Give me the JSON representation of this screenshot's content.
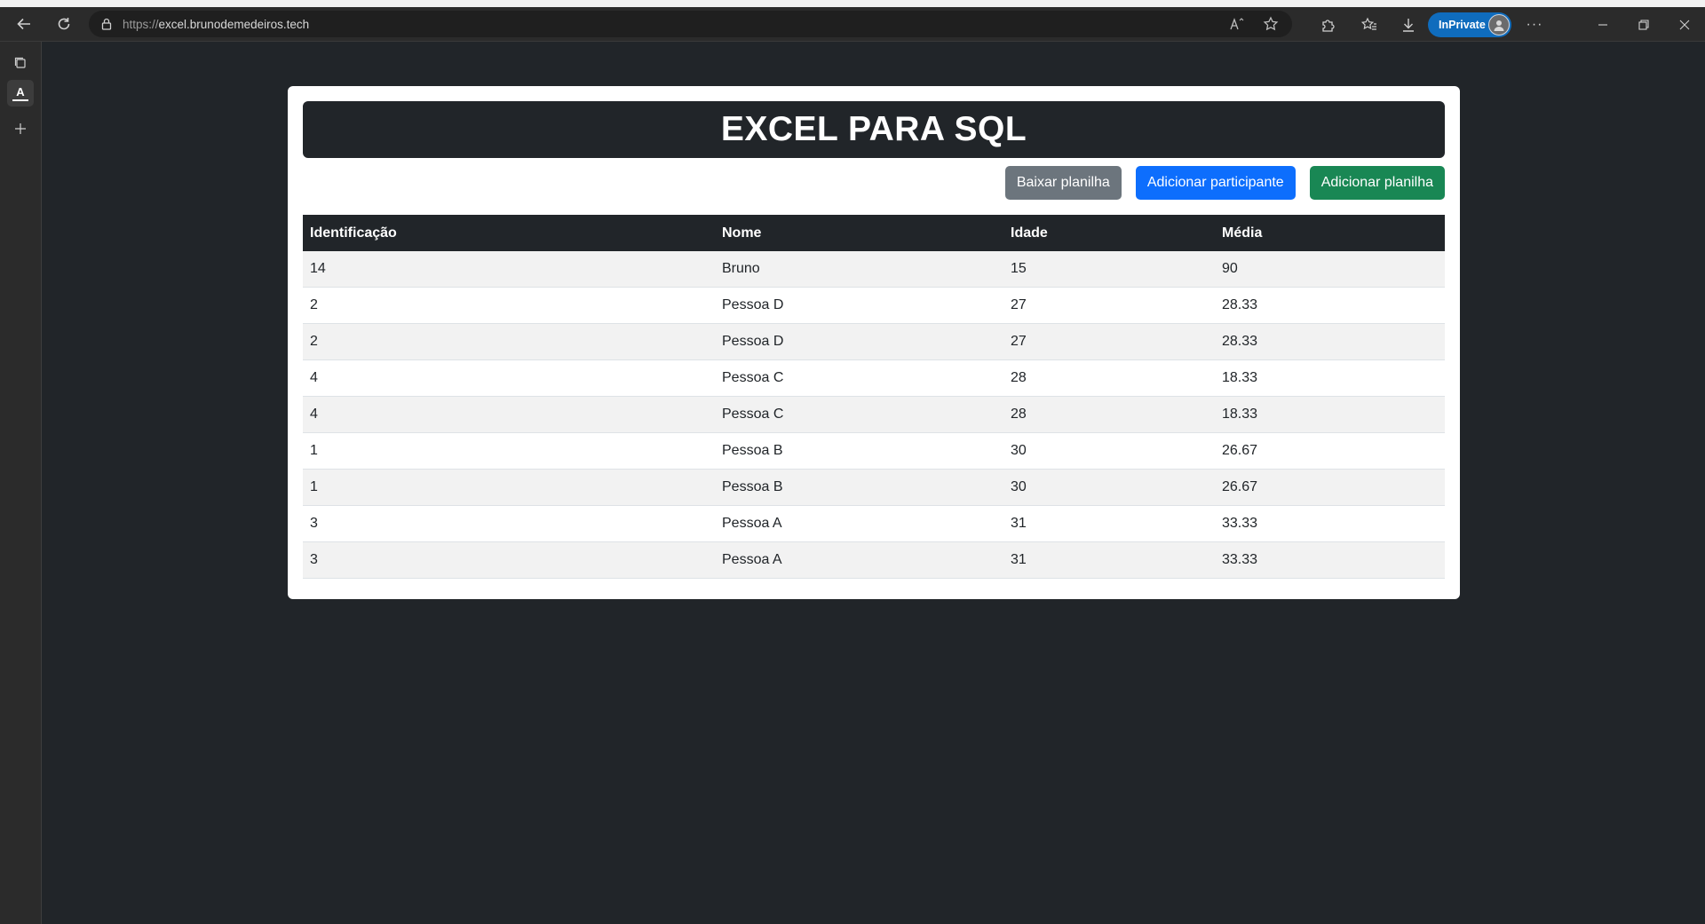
{
  "browser": {
    "url_protocol": "https://",
    "url_domain": "excel.brunodemedeiros.tech",
    "inprivate_label": "InPrivate"
  },
  "page": {
    "title": "EXCEL PARA SQL",
    "buttons": {
      "download": "Baixar planilha",
      "add_participant": "Adicionar participante",
      "add_sheet": "Adicionar planilha"
    },
    "table": {
      "headers": [
        "Identificação",
        "Nome",
        "Idade",
        "Média"
      ],
      "rows": [
        [
          "14",
          "Bruno",
          "15",
          "90"
        ],
        [
          "2",
          "Pessoa D",
          "27",
          "28.33"
        ],
        [
          "2",
          "Pessoa D",
          "27",
          "28.33"
        ],
        [
          "4",
          "Pessoa C",
          "28",
          "18.33"
        ],
        [
          "4",
          "Pessoa C",
          "28",
          "18.33"
        ],
        [
          "1",
          "Pessoa B",
          "30",
          "26.67"
        ],
        [
          "1",
          "Pessoa B",
          "30",
          "26.67"
        ],
        [
          "3",
          "Pessoa A",
          "31",
          "33.33"
        ],
        [
          "3",
          "Pessoa A",
          "31",
          "33.33"
        ]
      ]
    }
  },
  "colors": {
    "page_background": "#212529",
    "header_dark": "#212529",
    "btn_secondary": "#6c757d",
    "btn_primary": "#0d6efd",
    "btn_success": "#198754",
    "inprivate": "#0f6cbd"
  }
}
